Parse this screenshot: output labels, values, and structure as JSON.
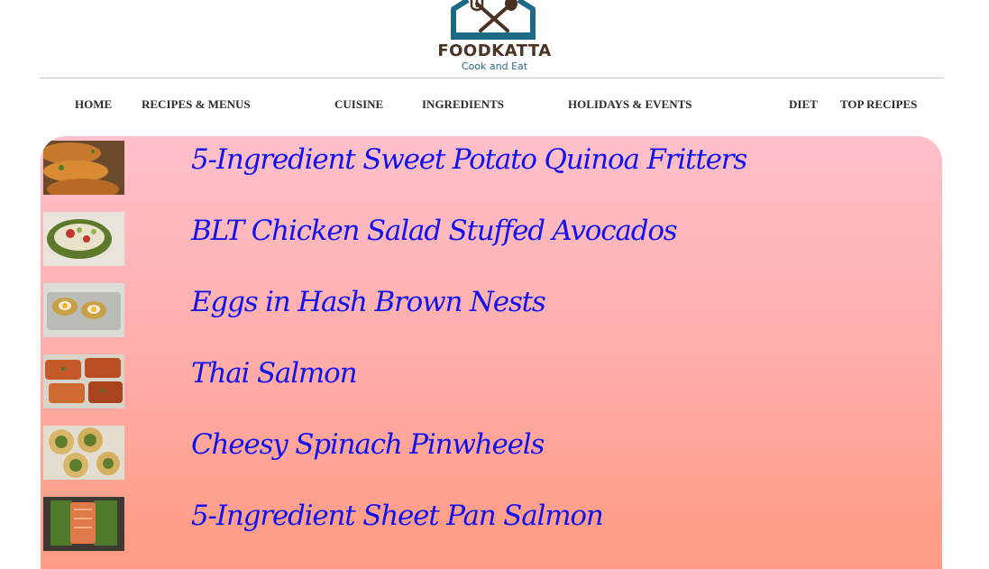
{
  "brand": {
    "name": "FOODKATTA",
    "tagline": "Cook and Eat",
    "colors": {
      "house": "#1d6a86",
      "utensils": "#4a3326",
      "tagline": "#2b6c8a"
    }
  },
  "nav": {
    "items": [
      {
        "label": "HOME"
      },
      {
        "label": "RECIPES & MENUS"
      },
      {
        "label": "CUISINE"
      },
      {
        "label": "INGREDIENTS"
      },
      {
        "label": "HOLIDAYS & EVENTS"
      },
      {
        "label": "DIET"
      },
      {
        "label": "TOP RECIPES"
      }
    ]
  },
  "recipes": {
    "title_color": "#1212ee",
    "panel_gradient": [
      "#ffc0cb",
      "#ff9b82"
    ],
    "items": [
      {
        "title": "5-Ingredient Sweet Potato Quinoa Fritters",
        "thumb": "fritters-photo"
      },
      {
        "title": "BLT Chicken Salad Stuffed Avocados",
        "thumb": "avocado-photo"
      },
      {
        "title": "Eggs in Hash Brown Nests",
        "thumb": "egg-nests-photo"
      },
      {
        "title": "Thai Salmon",
        "thumb": "thai-salmon-photo"
      },
      {
        "title": "Cheesy Spinach Pinwheels",
        "thumb": "pinwheels-photo"
      },
      {
        "title": "5-Ingredient Sheet Pan Salmon",
        "thumb": "sheet-pan-salmon-photo"
      }
    ]
  }
}
